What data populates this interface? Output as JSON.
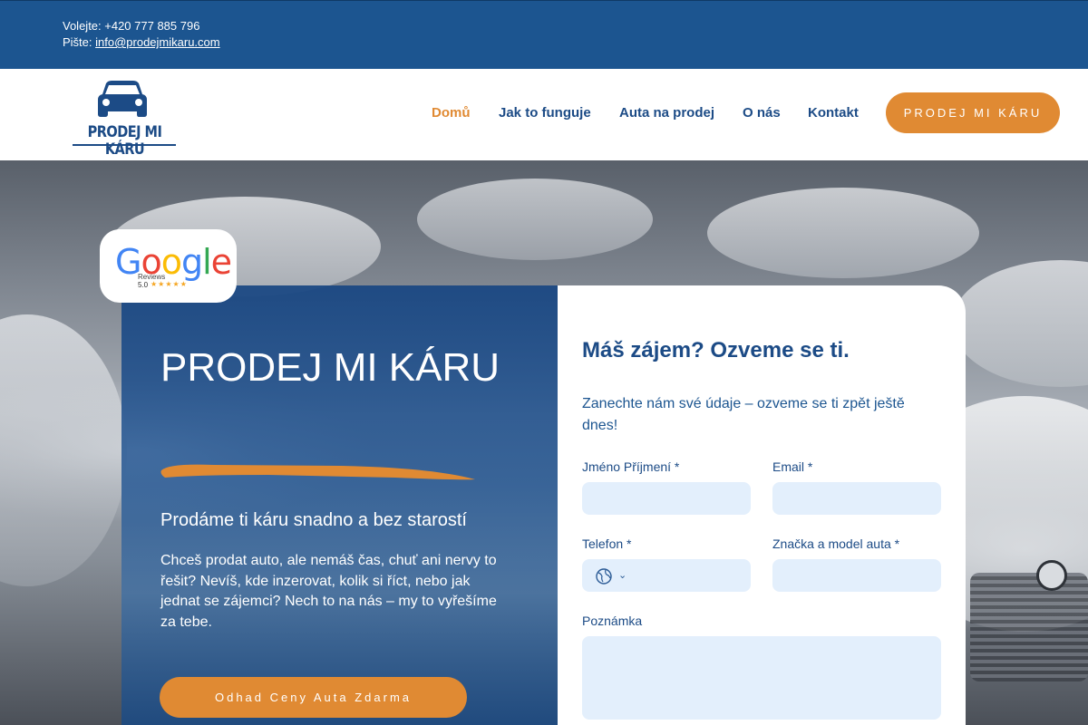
{
  "topbar": {
    "phone_line": "Volejte: +420 777 885 796",
    "email_prefix": "Pište: ",
    "email": "info@prodejmikaru.com"
  },
  "header": {
    "logo_text": "PRODEJ MI KÁRU",
    "nav": [
      {
        "label": "Domů",
        "active": true
      },
      {
        "label": "Jak to funguje",
        "active": false
      },
      {
        "label": "Auta na prodej",
        "active": false
      },
      {
        "label": "O nás",
        "active": false
      },
      {
        "label": "Kontakt",
        "active": false
      }
    ],
    "cta_label": "PRODEJ MI KÁRU"
  },
  "badge": {
    "brand": "Google",
    "reviews_label": "Reviews",
    "score": "5.0",
    "stars": "★★★★★"
  },
  "promo": {
    "title": "PRODEJ MI KÁRU",
    "subtitle": "Prodáme ti káru snadno a bez starostí",
    "text": "Chceš prodat auto, ale nemáš čas, chuť ani nervy to řešit? Nevíš, kde inzerovat, kolik si říct, nebo jak jednat se zájemci? Nech to na nás – my to vyřešíme za tebe.",
    "cta_label": "Odhad Ceny Auta Zdarma"
  },
  "form": {
    "title": "Máš zájem? Ozveme se ti.",
    "intro": "Zanechte nám své údaje – ozveme se ti zpět ještě dnes!",
    "fields": {
      "name_label": "Jméno Příjmení *",
      "email_label": "Email *",
      "phone_label": "Telefon *",
      "car_label": "Značka a model auta *",
      "note_label": "Poznámka"
    }
  },
  "colors": {
    "primary_blue": "#1c4b86",
    "accent_orange": "#e08a33",
    "field_bg": "#e3effc"
  },
  "icons": [
    "car-icon",
    "globe-icon",
    "chevron-down-icon",
    "star-icon"
  ]
}
